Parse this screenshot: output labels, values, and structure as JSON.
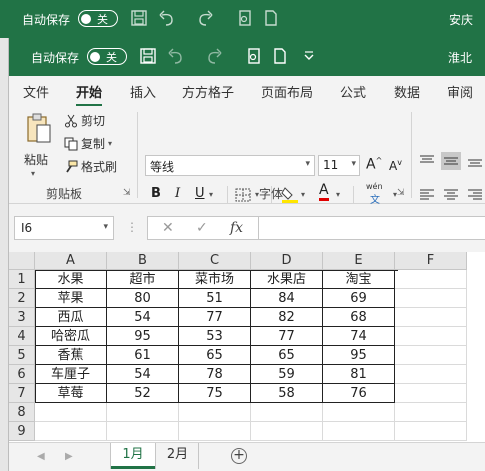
{
  "back_window": {
    "autosave_label": "自动保存",
    "autosave_state": "关",
    "user": "安庆"
  },
  "front_window": {
    "autosave_label": "自动保存",
    "autosave_state": "关",
    "user": "淮北"
  },
  "colors": {
    "accent": "#217346",
    "grid_line": "#dadada",
    "table_border": "#222222"
  },
  "ribbon_tabs": [
    "文件",
    "开始",
    "插入",
    "方方格子",
    "页面布局",
    "公式",
    "数据",
    "审阅"
  ],
  "active_tab": "开始",
  "clipboard": {
    "paste": "粘贴",
    "cut": "剪切",
    "copy": "复制",
    "format_painter": "格式刷",
    "group_label": "剪贴板"
  },
  "font": {
    "name": "等线",
    "size": "11",
    "bold": "B",
    "italic": "I",
    "underline": "U",
    "grow": "A",
    "shrink": "A",
    "phonetic": "wén",
    "phonetic_sub": "文",
    "group_label": "字体"
  },
  "formula_bar": {
    "name_box": "I6",
    "cancel": "✕",
    "enter": "✓",
    "fx": "fx",
    "formula": ""
  },
  "grid": {
    "columns": [
      "A",
      "B",
      "C",
      "D",
      "E",
      "F"
    ],
    "rows": [
      "1",
      "2",
      "3",
      "4",
      "5",
      "6",
      "7",
      "8",
      "9"
    ],
    "header": [
      "水果",
      "超市",
      "菜市场",
      "水果店",
      "淘宝"
    ],
    "data": [
      [
        "苹果",
        "80",
        "51",
        "84",
        "69"
      ],
      [
        "西瓜",
        "54",
        "77",
        "82",
        "68"
      ],
      [
        "哈密瓜",
        "95",
        "53",
        "77",
        "74"
      ],
      [
        "香蕉",
        "61",
        "65",
        "65",
        "95"
      ],
      [
        "车厘子",
        "54",
        "78",
        "59",
        "81"
      ],
      [
        "草莓",
        "52",
        "75",
        "58",
        "76"
      ]
    ]
  },
  "sheets": [
    "1月",
    "2月"
  ],
  "active_sheet": "1月",
  "add_sheet": "+"
}
